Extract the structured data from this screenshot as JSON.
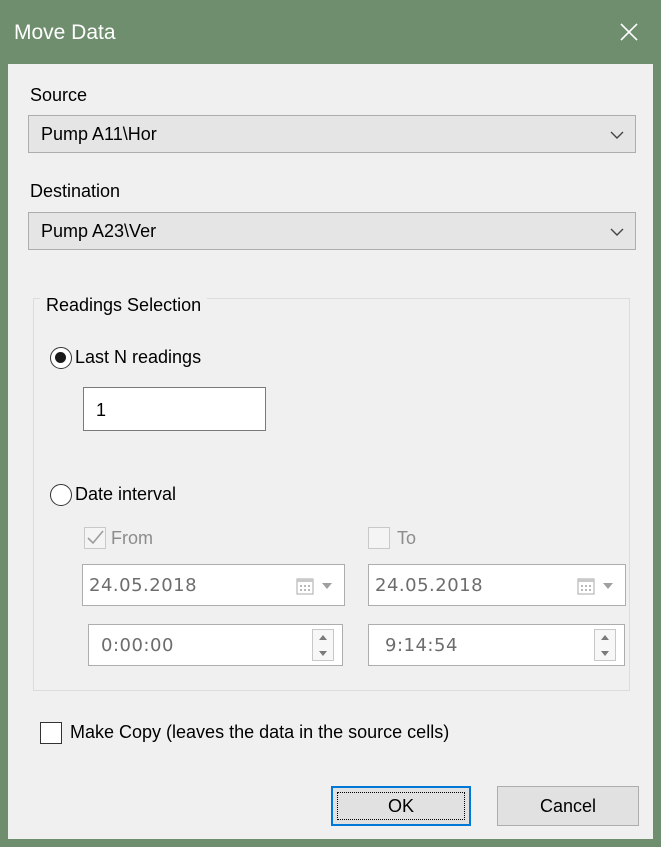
{
  "window": {
    "title": "Move Data"
  },
  "source": {
    "label": "Source",
    "value": "Pump A11\\Hor"
  },
  "destination": {
    "label": "Destination",
    "value": "Pump A23\\Ver"
  },
  "readings": {
    "legend": "Readings Selection",
    "last_n": {
      "label": "Last N readings",
      "selected": true,
      "value": "1"
    },
    "date_interval": {
      "label": "Date interval",
      "selected": false
    },
    "from": {
      "label": "From",
      "checked": true,
      "date": "24.05.2018",
      "time": "0:00:00"
    },
    "to": {
      "label": "To",
      "checked": false,
      "date": "24.05.2018",
      "time": "9:14:54"
    }
  },
  "make_copy": {
    "label": "Make Copy (leaves the data in the source cells)",
    "checked": false
  },
  "buttons": {
    "ok": "OK",
    "cancel": "Cancel"
  },
  "colors": {
    "titlebar": "#6f8e6d",
    "client": "#f0f0f0",
    "accent": "#0078d7"
  }
}
